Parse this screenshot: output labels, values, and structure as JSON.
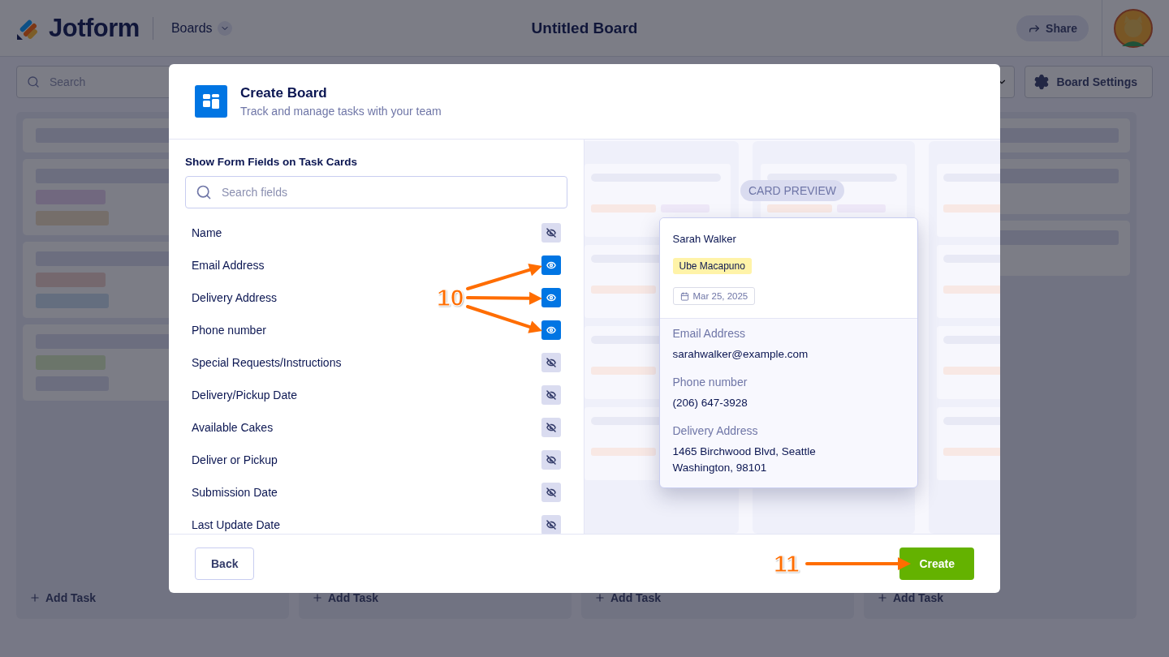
{
  "header": {
    "logo": "Jotform",
    "nav": "Boards",
    "title": "Untitled Board",
    "share": "Share"
  },
  "toolbar": {
    "search_placeholder": "Search",
    "settings": "Board Settings"
  },
  "columns": [
    {
      "add_task": "Add Task"
    },
    {
      "add_task": "Add Task"
    },
    {
      "add_task": "Add Task"
    },
    {
      "add_task": "Add Task"
    }
  ],
  "modal": {
    "title": "Create Board",
    "subtitle": "Track and manage tasks with your team",
    "section_title": "Show Form Fields on Task Cards",
    "search_placeholder": "Search fields",
    "fields": [
      {
        "label": "Name",
        "visible": false
      },
      {
        "label": "Email Address",
        "visible": true
      },
      {
        "label": "Delivery Address",
        "visible": true
      },
      {
        "label": "Phone number",
        "visible": true
      },
      {
        "label": "Special Requests/Instructions",
        "visible": false
      },
      {
        "label": "Delivery/Pickup Date",
        "visible": false
      },
      {
        "label": "Available Cakes",
        "visible": false
      },
      {
        "label": "Deliver or Pickup",
        "visible": false
      },
      {
        "label": "Submission Date",
        "visible": false
      },
      {
        "label": "Last Update Date",
        "visible": false
      }
    ],
    "preview_badge": "CARD PREVIEW",
    "card": {
      "name": "Sarah Walker",
      "tag": "Ube Macapuno",
      "date": "Mar 25, 2025",
      "details": [
        {
          "label": "Email Address",
          "lines": [
            "sarahwalker@example.com"
          ]
        },
        {
          "label": "Phone number",
          "lines": [
            "(206) 647-3928"
          ]
        },
        {
          "label": "Delivery Address",
          "lines": [
            "1465 Birchwood Blvd, Seattle",
            "Washington, 98101"
          ]
        }
      ]
    },
    "back": "Back",
    "create": "Create"
  },
  "annotations": [
    {
      "label": "10"
    },
    {
      "label": "11"
    }
  ]
}
